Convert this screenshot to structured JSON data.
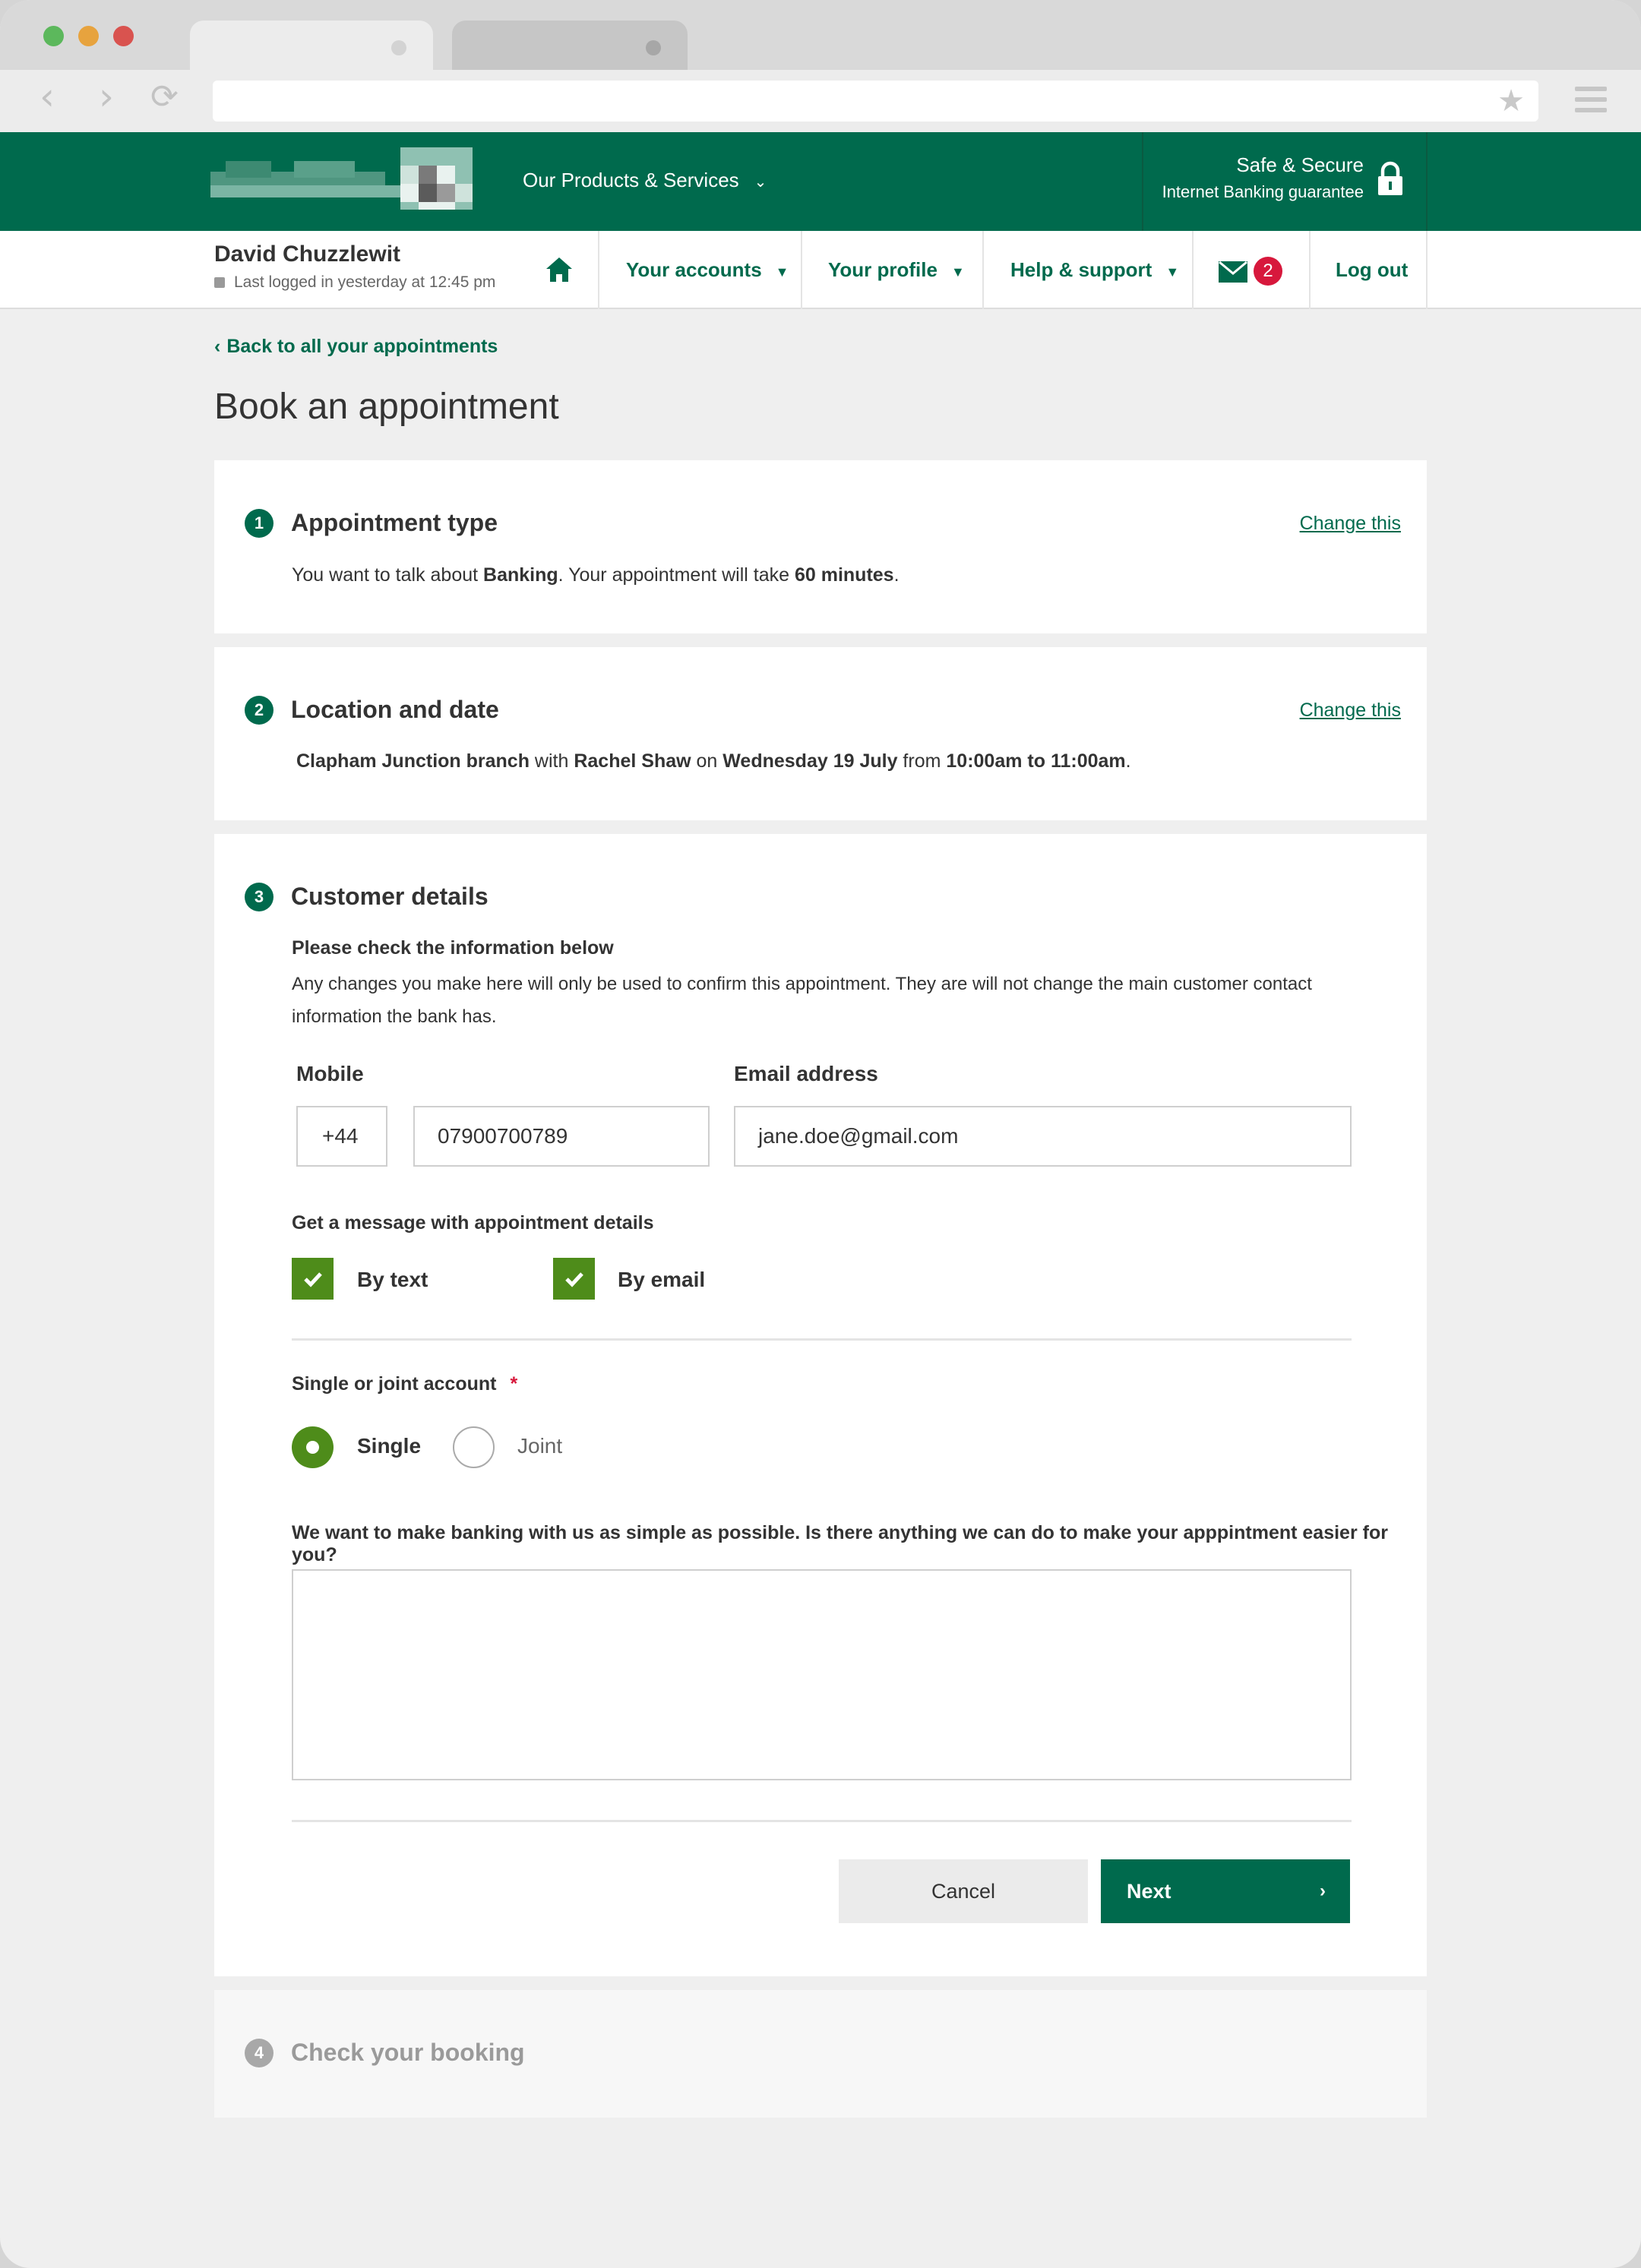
{
  "header": {
    "products_label": "Our Products & Services",
    "safe_title": "Safe & Secure",
    "safe_sub": "Internet Banking guarantee"
  },
  "user": {
    "name": "David Chuzzlewit",
    "last_login": "Last logged in yesterday at 12:45 pm"
  },
  "nav": {
    "accounts": "Your accounts",
    "profile": "Your profile",
    "help": "Help & support",
    "messages_count": "2",
    "logout": "Log out"
  },
  "page": {
    "back_link": "Back to all your appointments",
    "title": "Book an appointment"
  },
  "steps": {
    "s1": {
      "num": "1",
      "title": "Appointment type",
      "change": "Change this",
      "text_pre": "You want to talk about ",
      "topic": "Banking",
      "text_mid": ". Your appointment will take ",
      "duration": "60 minutes",
      "text_end": "."
    },
    "s2": {
      "num": "2",
      "title": "Location and date",
      "change": "Change this",
      "branch": "Clapham Junction branch",
      "with": " with ",
      "advisor": "Rachel Shaw",
      "on": " on ",
      "date": "Wednesday 19 July",
      "from": " from ",
      "time": "10:00am to 11:00am",
      "end": "."
    },
    "s3": {
      "num": "3",
      "title": "Customer details",
      "check_heading": "Please check the information below",
      "check_text": "Any changes you make here will only be used to confirm this appointment. They are will not change the main customer contact information the bank has.",
      "mobile_label": "Mobile",
      "country_code": "+44",
      "mobile_number": "07900700789",
      "email_label": "Email address",
      "email_value": "jane.doe@gmail.com",
      "message_heading": "Get a message with appointment details",
      "by_text": "By text",
      "by_email": "By email",
      "account_heading": "Single or joint account",
      "required_mark": "*",
      "single": "Single",
      "joint": "Joint",
      "question": "We want to make banking with us as simple as possible. Is there anything we can do to make your apppintment easier for you?",
      "cancel": "Cancel",
      "next": "Next"
    },
    "s4": {
      "num": "4",
      "title": "Check your booking"
    }
  },
  "colors": {
    "brand_green": "#006a4d",
    "check_green": "#4e8c1a",
    "badge_red": "#d7183c"
  }
}
